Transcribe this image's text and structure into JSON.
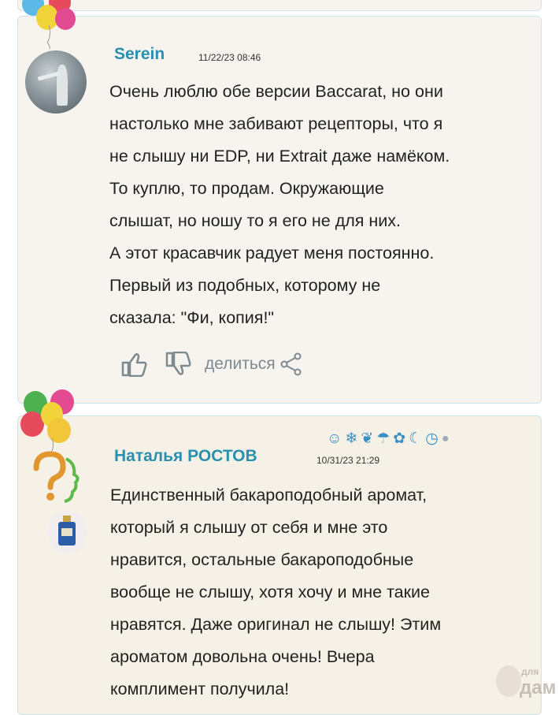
{
  "comments": [
    {
      "username": "Serein",
      "date": "11/22/23 08:46",
      "text": "Очень люблю обе версии Baccarat, но они\nнастолько мне забивают рецепторы, что я\nне слышу ни EDP, ни Extrait даже намёком.\nТо куплю, то продам. Окружающие\nслышат, но ношу то я его не для них.\nА этот красавчик радует меня постоянно.\nПервый из подобных, которому не\nсказала: \"Фи, копия!\"",
      "share_label": "делиться"
    },
    {
      "username": "Наталья РОСТОВ",
      "date": "10/31/23 21:29",
      "text": "Единственный бакароподобный аромат,\nкоторый я слышу от себя и мне это\nнравится, остальные бакароподобные\nвообще не слышу, хотя хочу и мне такие\nнравятся. Даже оригинал не слышу! Этим\nароматом довольна очень! Вчера\nкомплимент получила!"
    }
  ],
  "status_icons": [
    "smile-icon",
    "snowflake-icon",
    "leaf-icon",
    "umbrella-icon",
    "maple-leaf-icon",
    "moon-icon",
    "clock-icon",
    "stone-icon"
  ],
  "watermark": "для\nдам",
  "colors": {
    "username": "#2b8fae",
    "accent_icons": "#3a8fc4",
    "card_bg": "#f7f3ef",
    "card_border": "#cfe3ec"
  }
}
